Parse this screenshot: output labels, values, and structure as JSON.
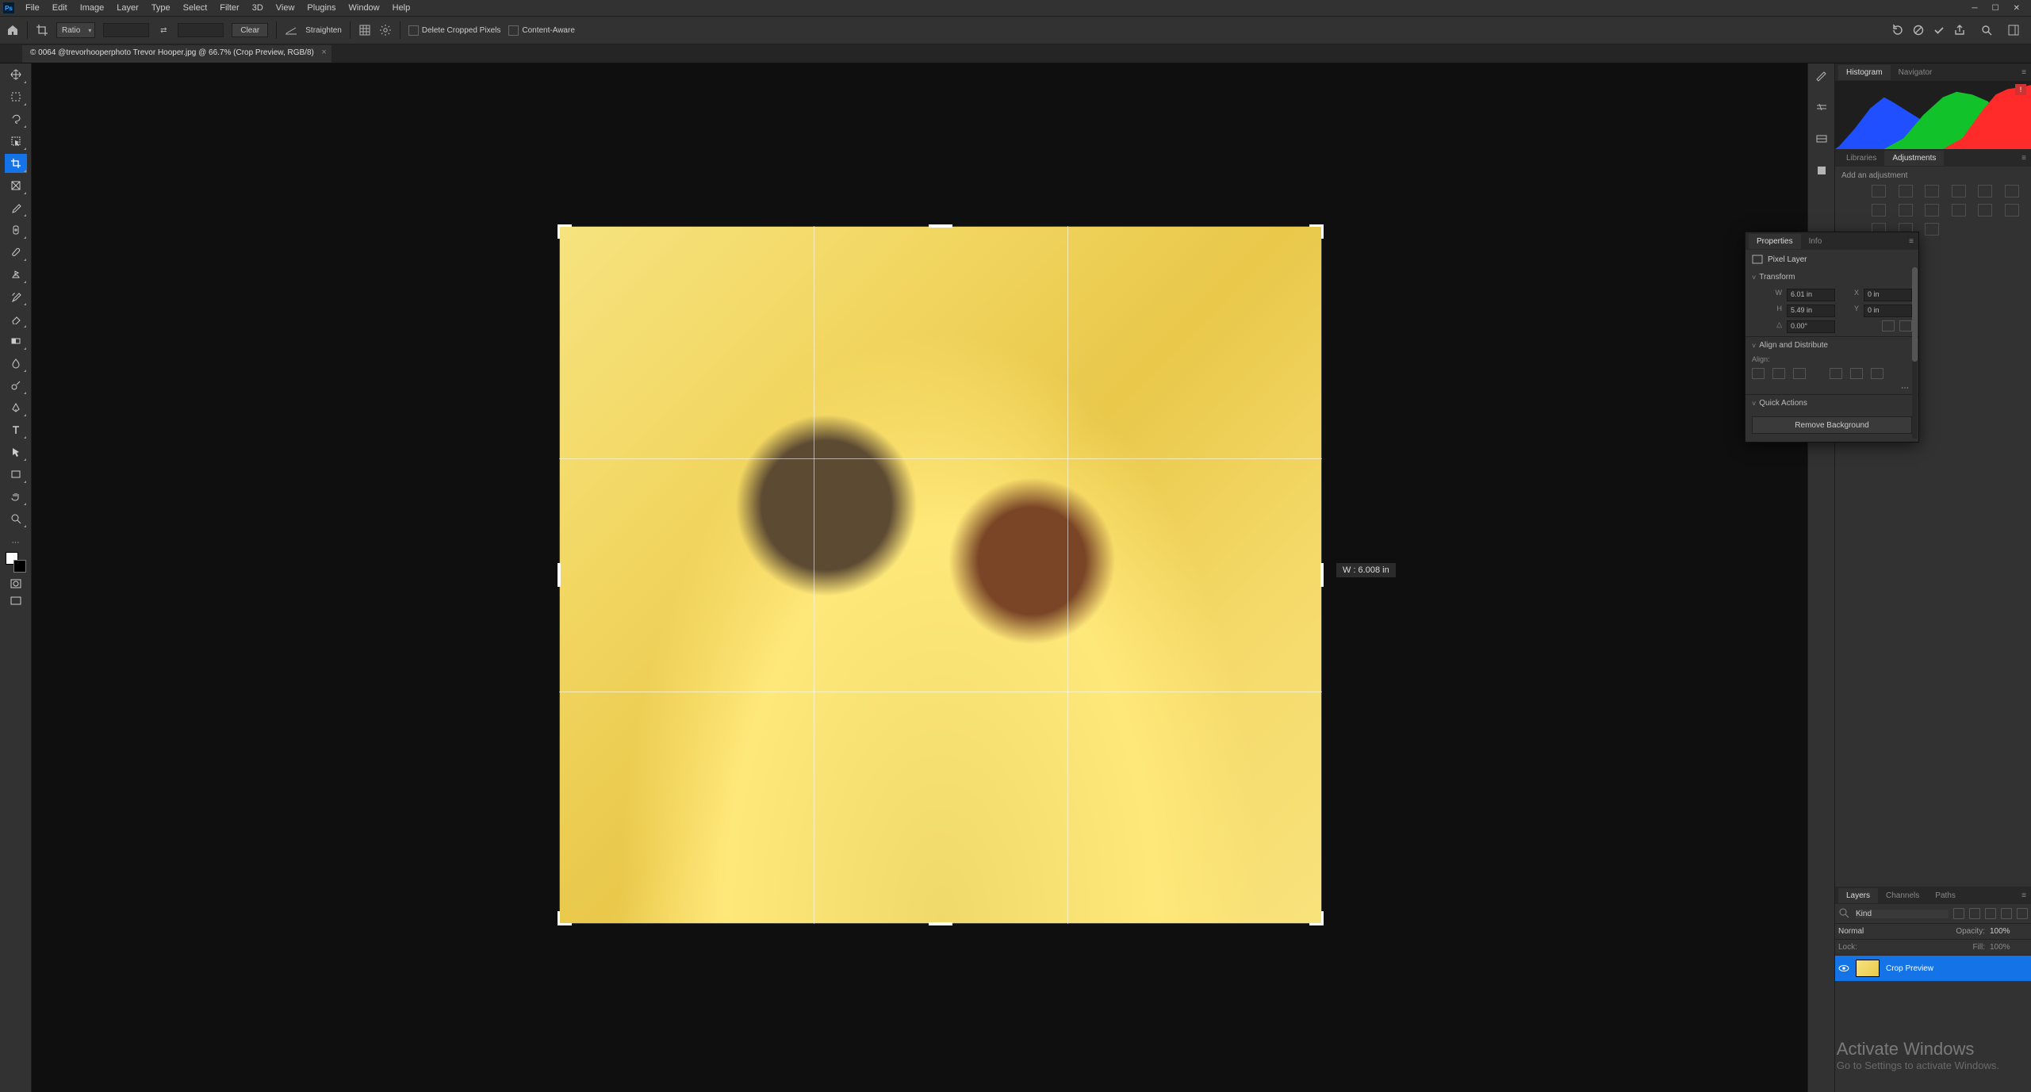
{
  "menubar": {
    "items": [
      "File",
      "Edit",
      "Image",
      "Layer",
      "Type",
      "Select",
      "Filter",
      "3D",
      "View",
      "Plugins",
      "Window",
      "Help"
    ]
  },
  "options": {
    "mode_label": "Ratio",
    "clear_label": "Clear",
    "straighten_label": "Straighten",
    "delete_cropped_label": "Delete Cropped Pixels",
    "content_aware_label": "Content-Aware"
  },
  "doc": {
    "tab_title": "© 0064 @trevorhooperphoto Trevor Hooper.jpg @ 66.7% (Crop Preview, RGB/8)"
  },
  "canvas": {
    "size_tip": "W :   6.008 in"
  },
  "rpanels": {
    "histogram_tab": "Histogram",
    "navigator_tab": "Navigator",
    "libraries_tab": "Libraries",
    "adjustments_tab": "Adjustments",
    "adjustments_hint": "Add an adjustment"
  },
  "properties": {
    "properties_tab": "Properties",
    "info_tab": "Info",
    "pixel_layer": "Pixel Layer",
    "transform_head": "Transform",
    "w_lbl": "W",
    "w_val": "6.01 in",
    "h_lbl": "H",
    "h_val": "5.49 in",
    "x_lbl": "X",
    "x_val": "0 in",
    "y_lbl": "Y",
    "y_val": "0 in",
    "angle_lbl": "△",
    "angle_val": "0.00°",
    "align_head": "Align and Distribute",
    "align_lbl": "Align:",
    "qa_head": "Quick Actions",
    "remove_bg": "Remove Background"
  },
  "layers": {
    "layers_tab": "Layers",
    "channels_tab": "Channels",
    "paths_tab": "Paths",
    "kind_label": "Kind",
    "blend_mode": "Normal",
    "opacity_label": "Opacity:",
    "opacity_val": "100%",
    "lock_label": "Lock:",
    "fill_label": "Fill:",
    "fill_val": "100%",
    "layer_name": "Crop Preview"
  },
  "watermark": {
    "line1": "Activate Windows",
    "line2": "Go to Settings to activate Windows."
  }
}
